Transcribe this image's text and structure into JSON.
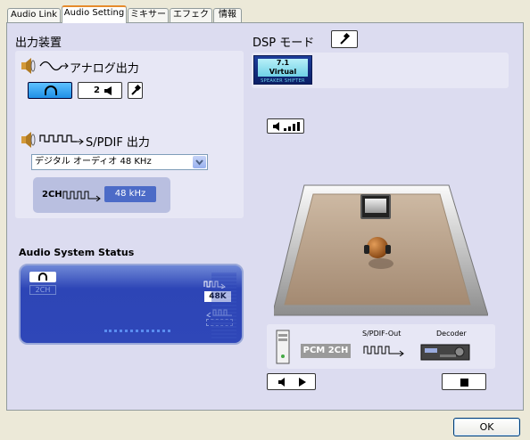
{
  "tabs": [
    {
      "label": "Audio Link"
    },
    {
      "label": "Audio Setting"
    },
    {
      "label": "ミキサー"
    },
    {
      "label": "エフェクト"
    },
    {
      "label": "情報"
    }
  ],
  "output_device": {
    "title": "出力装置",
    "analog_label": "アナログ出力",
    "speaker_count": "2",
    "spdif_label": "S/PDIF 出力",
    "spdif_select_value": "デジタル オーディオ 48 KHz",
    "spdif_channel": "2CH",
    "spdif_rate": "48 kHz"
  },
  "status": {
    "title": "Audio System Status",
    "channel": "2CH",
    "rate": "48K",
    "pcm_badge": "PCM 2CH",
    "spdif_out_label": "S/PDIF-Out",
    "decoder_label": "Decoder"
  },
  "dsp": {
    "title": "DSP モード",
    "virtual_top": "7.1",
    "virtual_mid": "Virtual",
    "virtual_bottom": "SPEAKER SHIFTER"
  },
  "ok_label": "OK",
  "colors": {
    "accent": "#e68b2c",
    "status_blue": "#2f47b8",
    "panel": "#e7e7f5"
  }
}
